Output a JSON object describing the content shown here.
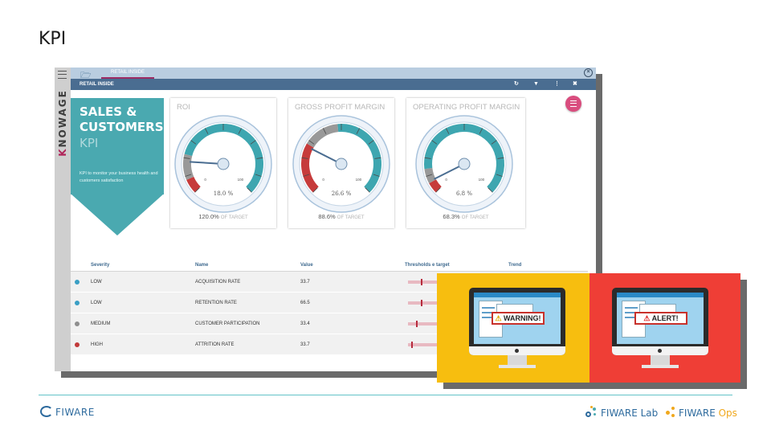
{
  "slide": {
    "title": "KPI"
  },
  "app": {
    "brand": "KNOWAGE",
    "tab_label": "RETAIL INSIDE",
    "toolbar_title": "RETAIL INSIDE",
    "toolbar_icons": [
      "refresh-icon",
      "filter-icon",
      "more-vertical-icon",
      "close-icon"
    ]
  },
  "hero": {
    "title_line1": "SALES &",
    "title_line2": "CUSTOMERS",
    "kpi": "KPI",
    "description": "KPI to monitor your business health and customers satisfaction"
  },
  "gauges": [
    {
      "title": "ROI",
      "value": 18.0,
      "value_text": "18.0 %",
      "target_value": "120.0%",
      "target_label": "OF TARGET",
      "min_label": "0",
      "max_label": "100"
    },
    {
      "title": "GROSS PROFIT MARGIN",
      "value": 26.6,
      "value_text": "26.6 %",
      "target_value": "88.6%",
      "target_label": "OF TARGET",
      "min_label": "0",
      "max_label": "100"
    },
    {
      "title": "OPERATING PROFIT MARGIN",
      "value": 6.8,
      "value_text": "6.8 %",
      "target_value": "68.3%",
      "target_label": "OF TARGET",
      "min_label": "0",
      "max_label": "100"
    }
  ],
  "table": {
    "headers": {
      "severity": "Severity",
      "name": "Name",
      "value": "Value",
      "thresholds": "Thresholds e target",
      "trend": "Trend"
    },
    "rows": [
      {
        "severity": "LOW",
        "name": "ACQUISITION RATE",
        "value": "33.7",
        "dot_color": "#3a9fc4"
      },
      {
        "severity": "LOW",
        "name": "RETENTION RATE",
        "value": "66.5",
        "dot_color": "#3a9fc4"
      },
      {
        "severity": "MEDIUM",
        "name": "CUSTOMER PARTICIPATION",
        "value": "33.4",
        "dot_color": "#8e8e8e"
      },
      {
        "severity": "HIGH",
        "name": "ATTRITION RATE",
        "value": "33.7",
        "dot_color": "#c23a3a"
      }
    ]
  },
  "illustration": {
    "warning_text": "WARNING!",
    "alert_text": "ALERT!"
  },
  "footer": {
    "fiware": "FIWARE",
    "fiware_lab_1": "FIWARE",
    "fiware_lab_2": "Lab",
    "fiware_ops_1": "FIWARE",
    "fiware_ops_2": "Ops"
  },
  "colors": {
    "teal": "#4aa9b0",
    "toolbar": "#4a6d91",
    "accent_pink": "#d94d7e",
    "warning_yellow": "#f7be0f",
    "alert_red": "#ef3e36"
  }
}
